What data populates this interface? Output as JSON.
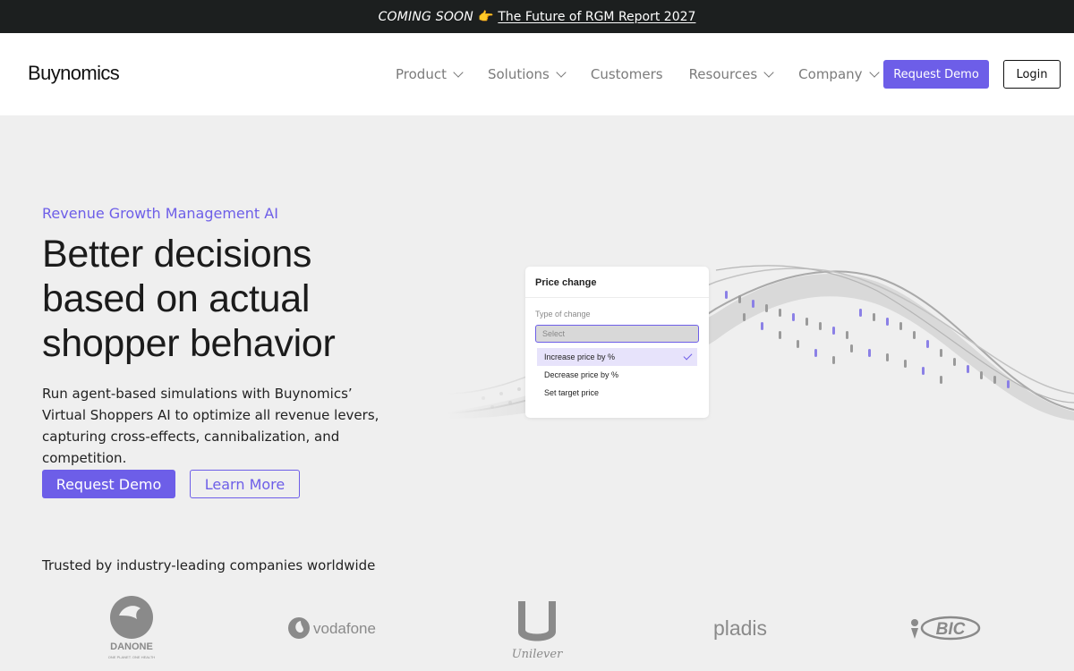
{
  "announcement": {
    "coming_soon": "COMING SOON",
    "emoji": "👉",
    "link": "The Future of RGM Report 2027"
  },
  "header": {
    "logo": "Buynomics",
    "nav": [
      {
        "label": "Product",
        "dropdown": true
      },
      {
        "label": "Solutions",
        "dropdown": true
      },
      {
        "label": "Customers",
        "dropdown": false
      },
      {
        "label": "Resources",
        "dropdown": true
      },
      {
        "label": "Company",
        "dropdown": true
      }
    ],
    "request_demo": "Request Demo",
    "login": "Login"
  },
  "hero": {
    "eyebrow": "Revenue Growth Management AI",
    "headline_l1": "Better decisions",
    "headline_l2": "based on actual",
    "headline_l3": "shopper behavior",
    "lead": "Run agent-based simulations with Buynomics’ Virtual Shoppers AI to optimize all revenue levers, capturing cross-effects, cannibalization, and competition.",
    "primary_cta": "Request Demo",
    "secondary_cta": "Learn More"
  },
  "price_card": {
    "title": "Price change",
    "field_label": "Type of change",
    "select_placeholder": "Select",
    "options": [
      {
        "label": "Increase price by %",
        "selected": true
      },
      {
        "label": "Decrease price by %",
        "selected": false
      },
      {
        "label": "Set target price",
        "selected": false
      }
    ]
  },
  "trusted": {
    "heading": "Trusted by industry-leading companies worldwide",
    "logos": [
      {
        "name": "DANONE",
        "tagline": "ONE PLANET. ONE HEALTH"
      },
      {
        "name": "vodafone"
      },
      {
        "name": "Unilever"
      },
      {
        "name": "pladis"
      },
      {
        "name": "BIC"
      }
    ]
  },
  "colors": {
    "accent": "#6d5ee8",
    "announcement_bg": "#1c1f1f",
    "page_bg": "#efefef"
  }
}
